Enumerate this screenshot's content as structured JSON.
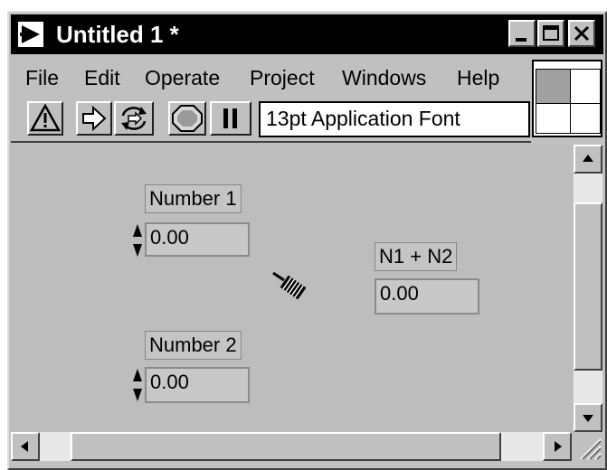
{
  "window": {
    "title": "Untitled 1 *"
  },
  "menu": {
    "items": [
      {
        "id": "file",
        "label": "File"
      },
      {
        "id": "edit",
        "label": "Edit"
      },
      {
        "id": "operate",
        "label": "Operate"
      },
      {
        "id": "project",
        "label": "Project"
      },
      {
        "id": "windows",
        "label": "Windows"
      },
      {
        "id": "help",
        "label": "Help"
      }
    ]
  },
  "toolbar": {
    "font": "13pt Application Font",
    "icons": [
      "warning-icon",
      "run-arrow-icon",
      "run-continuously-icon",
      "abort-icon",
      "pause-icon"
    ]
  },
  "panel": {
    "controls": [
      {
        "label": "Number 1",
        "value": "0.00",
        "kind": "control"
      },
      {
        "label": "Number 2",
        "value": "0.00",
        "kind": "control"
      }
    ],
    "indicator": {
      "label": "N1 + N2",
      "value": "0.00",
      "kind": "indicator"
    }
  },
  "colors": {
    "canvas": "#bdbdbd",
    "titlebar": "#000000",
    "chrome": "#c0c0c0"
  }
}
